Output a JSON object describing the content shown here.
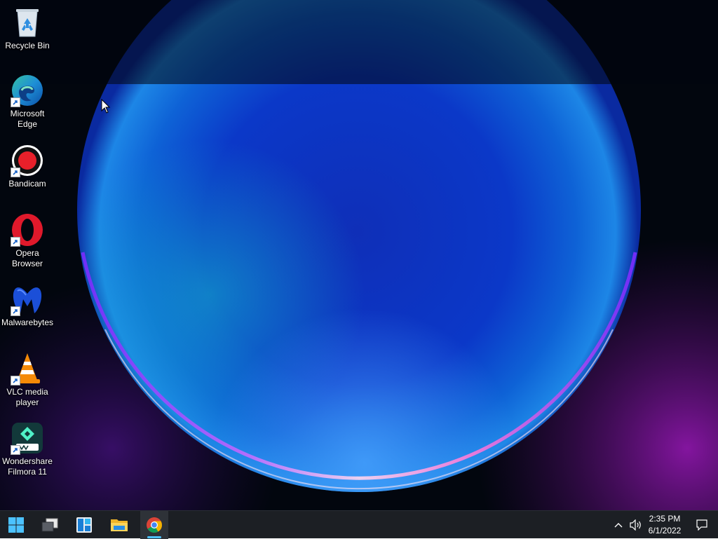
{
  "desktop": {
    "icons": [
      {
        "label": "Recycle Bin",
        "icon": "recycle-bin-icon",
        "shortcut": false
      },
      {
        "label": "Microsoft Edge",
        "icon": "edge-icon",
        "shortcut": true
      },
      {
        "label": "Bandicam",
        "icon": "bandicam-icon",
        "shortcut": true
      },
      {
        "label": "Opera Browser",
        "icon": "opera-icon",
        "shortcut": true
      },
      {
        "label": "Malwarebytes",
        "icon": "malwarebytes-icon",
        "shortcut": true
      },
      {
        "label": "VLC media player",
        "icon": "vlc-icon",
        "shortcut": true
      },
      {
        "label": "Wondershare Filmora 11",
        "icon": "filmora-icon",
        "shortcut": true
      }
    ]
  },
  "taskbar": {
    "buttons": [
      {
        "name": "Start",
        "icon": "windows-logo-icon"
      },
      {
        "name": "Task View",
        "icon": "task-view-icon"
      },
      {
        "name": "Widgets",
        "icon": "widgets-icon"
      },
      {
        "name": "File Explorer",
        "icon": "folder-icon"
      },
      {
        "name": "Google Chrome",
        "icon": "chrome-icon",
        "active": true
      }
    ],
    "tray": {
      "time": "2:35 PM",
      "date": "6/1/2022"
    }
  },
  "colors": {
    "taskbar_bg": "#1c1f24",
    "accent": "#4cc2ff"
  }
}
